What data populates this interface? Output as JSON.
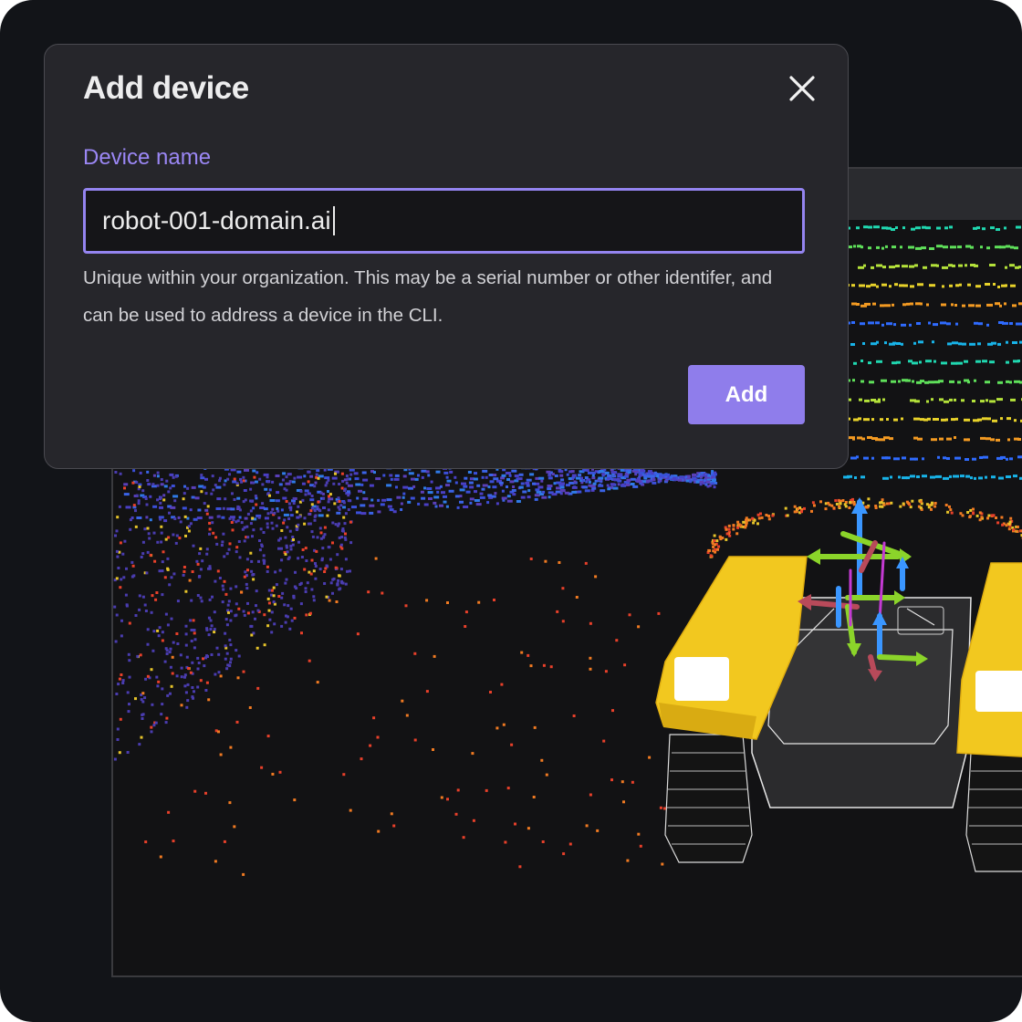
{
  "dialog": {
    "title": "Add device",
    "close_icon": "close-icon",
    "field_label": "Device name",
    "field_value": "robot-001-domain.ai",
    "help_text": "Unique within your organization. This may be a serial number or other identifer, and can be used to address a device in the CLI.",
    "add_label": "Add"
  },
  "colors": {
    "accent": "#9484f0",
    "button": "#8f7deb",
    "dialog_bg": "#26262b",
    "background": "#121418",
    "robot_body": "#f2c81f"
  }
}
